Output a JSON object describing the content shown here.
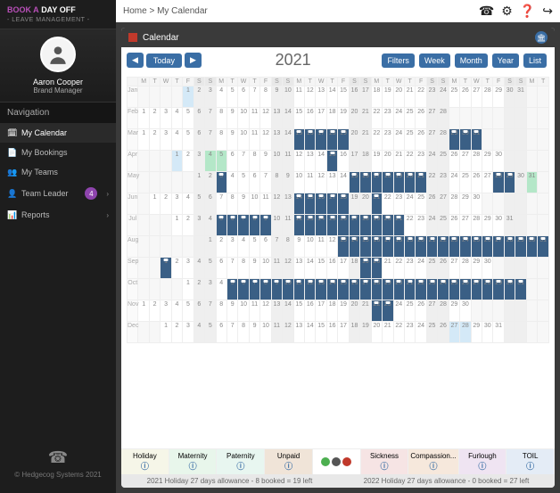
{
  "logo": {
    "line1a": "BOOK A",
    "line1b": "DAY OFF",
    "line2": "- LEAVE MANAGEMENT -"
  },
  "user": {
    "name": "Aaron Cooper",
    "title": "Brand Manager"
  },
  "nav_header": "Navigation",
  "nav": [
    {
      "icon": "calendar",
      "label": "My Calendar",
      "active": true
    },
    {
      "icon": "list",
      "label": "My Bookings"
    },
    {
      "icon": "users",
      "label": "My Teams"
    },
    {
      "icon": "lead",
      "label": "Team Leader",
      "badge": "4",
      "chev": true
    },
    {
      "icon": "chart",
      "label": "Reports",
      "chev": true
    }
  ],
  "copyright": "© Hedgecog Systems 2021",
  "breadcrumb": "Home > My Calendar",
  "panel_title": "Calendar",
  "toolbar": {
    "today": "Today"
  },
  "year": "2021",
  "scopes": [
    "Filters",
    "Week",
    "Month",
    "Year",
    "List"
  ],
  "dow": [
    "M",
    "T",
    "W",
    "T",
    "F",
    "S",
    "S"
  ],
  "months": [
    "Jan",
    "Feb",
    "Mar",
    "Apr",
    "May",
    "Jun",
    "Jul",
    "Aug",
    "Sep",
    "Oct",
    "Nov",
    "Dec"
  ],
  "month_lengths": [
    31,
    28,
    31,
    30,
    31,
    30,
    31,
    31,
    30,
    31,
    30,
    31
  ],
  "month_start_dow": [
    4,
    0,
    0,
    3,
    5,
    1,
    3,
    6,
    2,
    4,
    0,
    2
  ],
  "bookings": {
    "Jan": [],
    "Feb": [],
    "Mar": [
      15,
      16,
      17,
      18,
      19,
      29,
      30,
      31
    ],
    "Apr": [
      15
    ],
    "May": [
      3,
      15,
      16,
      17,
      18,
      19,
      20,
      21,
      28,
      29
    ],
    "Jun": [
      14,
      15,
      16,
      17,
      18,
      21
    ],
    "Jul": [
      5,
      6,
      7,
      8,
      9,
      12,
      13,
      14,
      15,
      16,
      17,
      18,
      19,
      20,
      21
    ],
    "Aug": [
      13,
      14,
      15,
      16,
      17,
      18,
      19,
      20,
      21,
      22,
      23,
      24,
      25,
      26,
      27,
      28,
      29,
      30,
      31
    ],
    "Sep": [
      1,
      19,
      20
    ],
    "Oct": [
      5,
      6,
      7,
      8,
      9,
      10,
      11,
      12,
      13,
      14,
      15,
      16,
      17,
      18,
      19,
      20,
      21,
      22,
      23,
      24,
      25,
      26,
      27,
      28,
      29,
      30,
      31
    ],
    "Nov": [
      22,
      23
    ],
    "Dec": []
  },
  "highlights": {
    "Jan": {
      "1": "b"
    },
    "Apr": {
      "1": "b",
      "4": "a",
      "5": "a"
    },
    "May": {
      "3": "a",
      "31": "a"
    },
    "Aug": {
      "30": "a",
      "31": "b"
    },
    "Dec": {
      "27": "b",
      "28": "b"
    }
  },
  "legend": [
    {
      "key": "holiday",
      "label": "Holiday"
    },
    {
      "key": "maternity",
      "label": "Maternity"
    },
    {
      "key": "paternity",
      "label": "Paternity"
    },
    {
      "key": "unpaid",
      "label": "Unpaid"
    },
    {
      "key": "status",
      "label": ""
    },
    {
      "key": "sickness",
      "label": "Sickness"
    },
    {
      "key": "comp",
      "label": "Compassion..."
    },
    {
      "key": "furlough",
      "label": "Furlough"
    },
    {
      "key": "toil",
      "label": "TOIL"
    }
  ],
  "footer": {
    "left": "2021 Holiday 27 days allowance - 8 booked = 19 left",
    "right": "2022 Holiday 27 days allowance - 0 booked = 27 left"
  }
}
